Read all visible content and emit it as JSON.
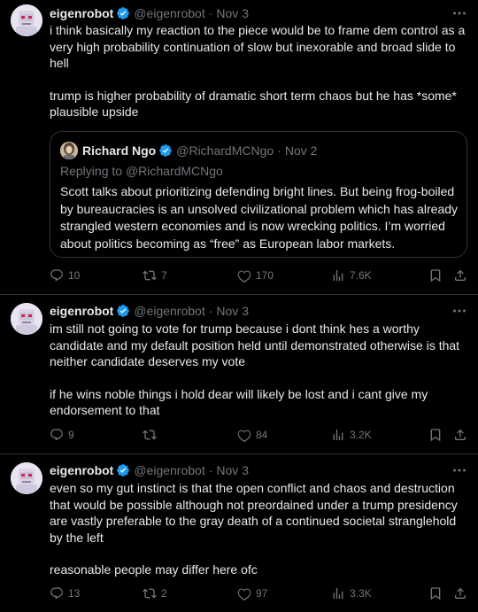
{
  "tweets": [
    {
      "author": {
        "name": "eigenrobot",
        "handle": "@eigenrobot",
        "date": "Nov 3"
      },
      "paragraphs": [
        "i think basically my reaction to the piece would be to frame dem control as a very high probability continuation of slow but inexorable and broad slide to hell",
        "trump is higher probability of dramatic short term chaos but he has *some* plausible upside"
      ],
      "quote": {
        "author": {
          "name": "Richard Ngo",
          "handle": "@RichardMCNgo",
          "date": "Nov 2"
        },
        "replying_prefix": "Replying to",
        "replying_to": "@RichardMCNgo",
        "text": "Scott talks about prioritizing defending bright lines. But being frog-boiled by bureaucracies is an unsolved civilizational problem which has already strangled western economies and is now wrecking politics. I’m worried about politics becoming as “free” as European labor markets."
      },
      "stats": {
        "replies": "10",
        "retweets": "7",
        "likes": "170",
        "views": "7.6K"
      }
    },
    {
      "author": {
        "name": "eigenrobot",
        "handle": "@eigenrobot",
        "date": "Nov 3"
      },
      "paragraphs": [
        "im still not going to vote for trump because i dont think hes a worthy candidate and my default position held until demonstrated otherwise is that neither candidate deserves my vote",
        "if he wins noble things i hold dear will likely be lost and i cant give my endorsement to that"
      ],
      "stats": {
        "replies": "9",
        "retweets": "",
        "likes": "84",
        "views": "3.2K"
      }
    },
    {
      "author": {
        "name": "eigenrobot",
        "handle": "@eigenrobot",
        "date": "Nov 3"
      },
      "paragraphs": [
        "even so my gut instinct is that the open conflict and chaos and destruction that would be possible although not preordained under a trump presidency are vastly preferable to the gray death of a continued societal stranglehold by the left",
        "reasonable people may differ here ofc"
      ],
      "stats": {
        "replies": "13",
        "retweets": "2",
        "likes": "97",
        "views": "3.3K"
      }
    }
  ],
  "separator": "·",
  "colors": {
    "background": "#000000",
    "text": "#e7e9ea",
    "muted": "#71767b",
    "border": "#2f3336",
    "verified": "#1d9bf0"
  },
  "icons": [
    "verified-badge-icon",
    "more-icon",
    "reply-icon",
    "retweet-icon",
    "like-icon",
    "views-icon",
    "bookmark-icon",
    "share-icon"
  ]
}
